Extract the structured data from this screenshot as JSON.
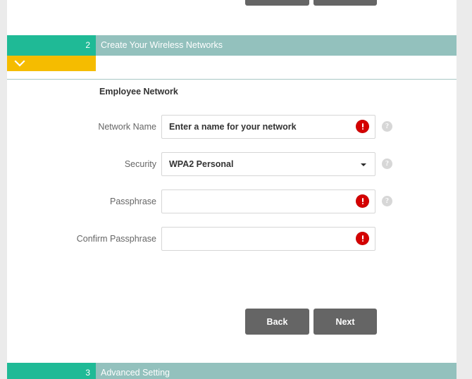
{
  "window": {
    "background_color": "#ebebeb",
    "panel_color": "#ffffff"
  },
  "top_buttons": [
    {
      "name": "top-button-left",
      "label": ""
    },
    {
      "name": "top-button-right",
      "label": ""
    }
  ],
  "section": {
    "number": "2",
    "title": "Create Your Wireless Networks",
    "number_block_color": "#1fba96",
    "header_color": "#93c1bd",
    "collapse_bar_color": "#f5bc00",
    "collapse_icon": "chevron-down-icon"
  },
  "form": {
    "group_title": "Employee Network",
    "fields": [
      {
        "label": "Network Name",
        "value": "Enter a name for your network",
        "placeholder": "Enter a name for your network",
        "type": "text",
        "empty": false,
        "has_error": true,
        "has_help": true
      },
      {
        "label": "Security",
        "value": "WPA2 Personal",
        "placeholder": "",
        "type": "select",
        "empty": false,
        "has_error": false,
        "has_help": true,
        "options": [
          "WPA2 Personal"
        ]
      },
      {
        "label": "Passphrase",
        "value": "",
        "placeholder": "",
        "type": "password",
        "empty": true,
        "has_error": true,
        "has_help": true
      },
      {
        "label": "Confirm Passphrase",
        "value": "",
        "placeholder": "",
        "type": "password",
        "empty": true,
        "has_error": true,
        "has_help": false
      }
    ]
  },
  "actions": {
    "back_label": "Back",
    "next_label": "Next",
    "button_color": "#656565"
  },
  "next_section": {
    "number": "3",
    "title": "Advanced Setting"
  },
  "icons": {
    "error": "error-icon",
    "help": "?",
    "caret": "chevron-down-icon"
  }
}
